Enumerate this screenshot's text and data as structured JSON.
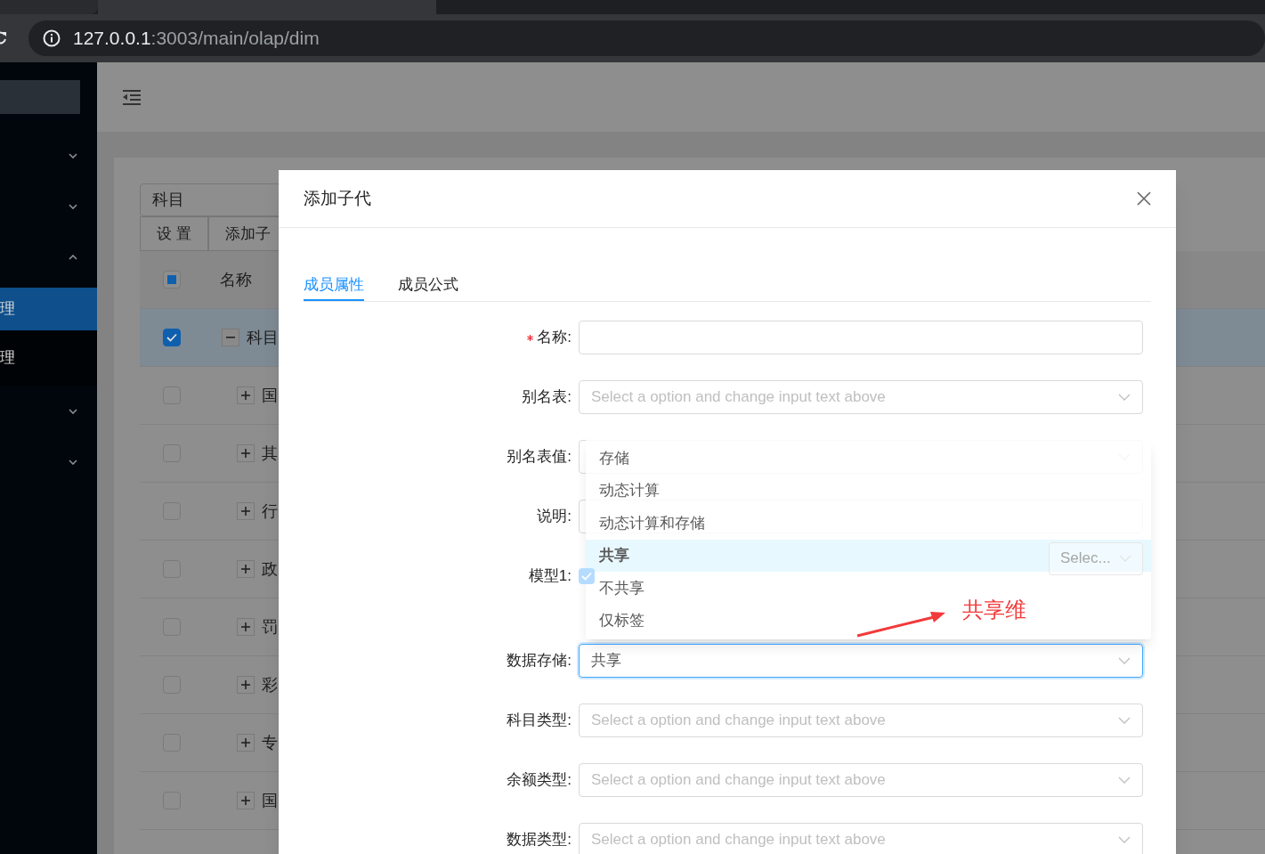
{
  "browser": {
    "url_host": "127.0.0.1",
    "url_path": ":3003/main/olap/dim"
  },
  "sidebar": {
    "items": [
      {
        "kind": "submenu",
        "expanded": false
      },
      {
        "kind": "submenu",
        "expanded": false
      },
      {
        "kind": "submenu",
        "expanded": true,
        "children": [
          {
            "label": "理",
            "selected": true
          },
          {
            "label": "理",
            "selected": false
          }
        ]
      },
      {
        "kind": "submenu",
        "expanded": false
      },
      {
        "kind": "submenu",
        "expanded": false
      }
    ]
  },
  "card": {
    "select_value": "科目",
    "buttons": [
      "设 置",
      "添加子"
    ],
    "table": {
      "header": {
        "label": "名称",
        "checked": false,
        "indeterminate": true
      },
      "rows": [
        {
          "label": "科目",
          "checked": true,
          "expanded": true,
          "selected": true
        },
        {
          "label": "国",
          "checked": false,
          "expanded": false,
          "selected": false
        },
        {
          "label": "其",
          "checked": false,
          "expanded": false,
          "selected": false
        },
        {
          "label": "行",
          "checked": false,
          "expanded": false,
          "selected": false
        },
        {
          "label": "政",
          "checked": false,
          "expanded": false,
          "selected": false
        },
        {
          "label": "罚",
          "checked": false,
          "expanded": false,
          "selected": false
        },
        {
          "label": "彩",
          "checked": false,
          "expanded": false,
          "selected": false
        },
        {
          "label": "专",
          "checked": false,
          "expanded": false,
          "selected": false
        },
        {
          "label": "国",
          "checked": false,
          "expanded": false,
          "selected": false
        }
      ]
    }
  },
  "modal": {
    "title": "添加子代",
    "tabs": [
      {
        "label": "成员属性",
        "selected": true
      },
      {
        "label": "成员公式",
        "selected": false
      }
    ],
    "fields": [
      {
        "kind": "input",
        "label": "名称:",
        "required": true
      },
      {
        "kind": "select",
        "label": "别名表:",
        "placeholder": "Select a option and change input text above",
        "required": false
      },
      {
        "kind": "select",
        "label": "别名表值:",
        "required": false
      },
      {
        "kind": "input",
        "label": "说明:",
        "required": false
      },
      {
        "kind": "checkbox_select",
        "label": "模型1:",
        "checked": true,
        "placeholder": "Selec...",
        "required": false
      },
      {
        "kind": "select",
        "label": "数据存储:",
        "value": "共享",
        "focused": true,
        "required": false
      },
      {
        "kind": "select",
        "label": "科目类型:",
        "placeholder": "Select a option and change input text above",
        "required": false
      },
      {
        "kind": "select",
        "label": "余额类型:",
        "placeholder": "Select a option and change input text above",
        "required": false
      },
      {
        "kind": "select",
        "label": "数据类型:",
        "placeholder": "Select a option and change input text above",
        "required": false
      }
    ],
    "dropdown": {
      "options": [
        {
          "label": "存储",
          "selected": false
        },
        {
          "label": "动态计算",
          "selected": false
        },
        {
          "label": "动态计算和存储",
          "selected": false
        },
        {
          "label": "共享",
          "selected": true
        },
        {
          "label": "不共享",
          "selected": false
        },
        {
          "label": "仅标签",
          "selected": false
        }
      ]
    },
    "annotation": {
      "text": "共享维"
    }
  }
}
